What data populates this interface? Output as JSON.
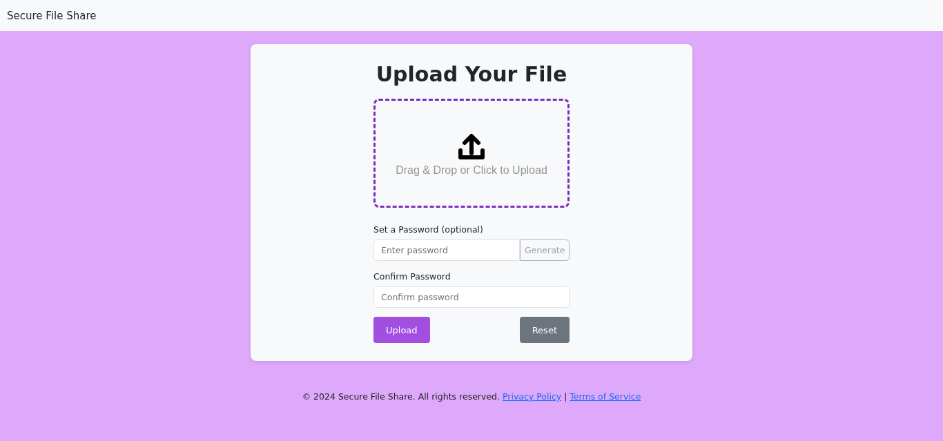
{
  "navbar": {
    "brand": "Secure File Share"
  },
  "card": {
    "title": "Upload Your File",
    "dropzone": {
      "text": "Drag & Drop or Click to Upload"
    },
    "password": {
      "label": "Set a Password (optional)",
      "placeholder": "Enter password",
      "generate": "Generate"
    },
    "confirm": {
      "label": "Confirm Password",
      "placeholder": "Confirm password"
    },
    "buttons": [
      {
        "label": "Upload",
        "kind": "primary"
      },
      {
        "label": "Reset",
        "kind": "secondary"
      }
    ]
  },
  "footer": {
    "text": "© 2024 Secure File Share. All rights reserved.",
    "links": [
      "Privacy Policy",
      "Terms of Service"
    ],
    "separator": "|"
  }
}
